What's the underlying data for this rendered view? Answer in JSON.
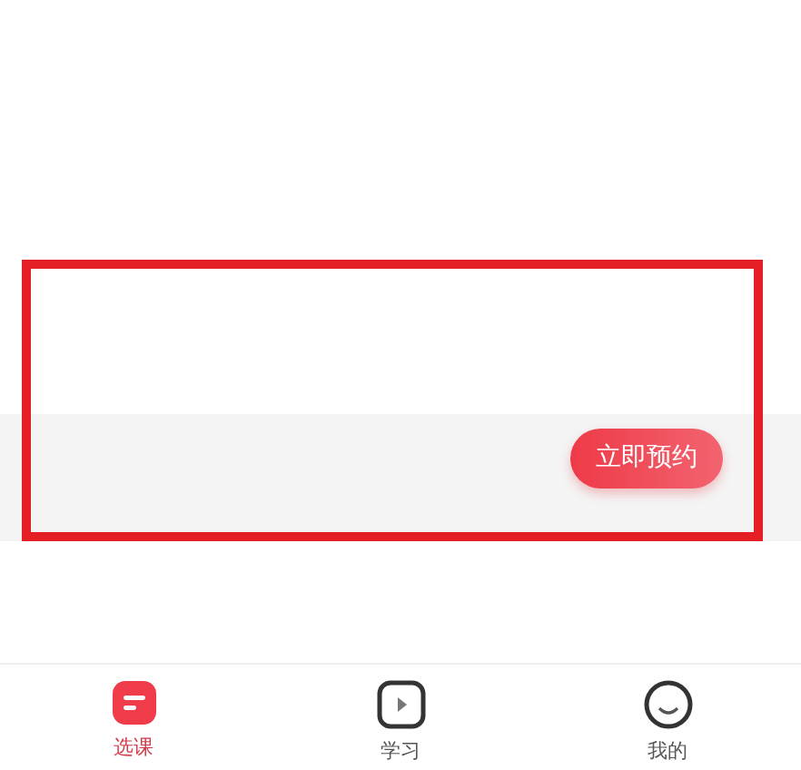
{
  "card": {
    "button": "立即预约"
  },
  "tab_bar": [
    {
      "label": "选课",
      "kind": "list",
      "selected": true
    },
    {
      "label": "学习",
      "kind": "play",
      "selected": false
    },
    {
      "label": "我的",
      "kind": "face",
      "selected": false
    }
  ]
}
